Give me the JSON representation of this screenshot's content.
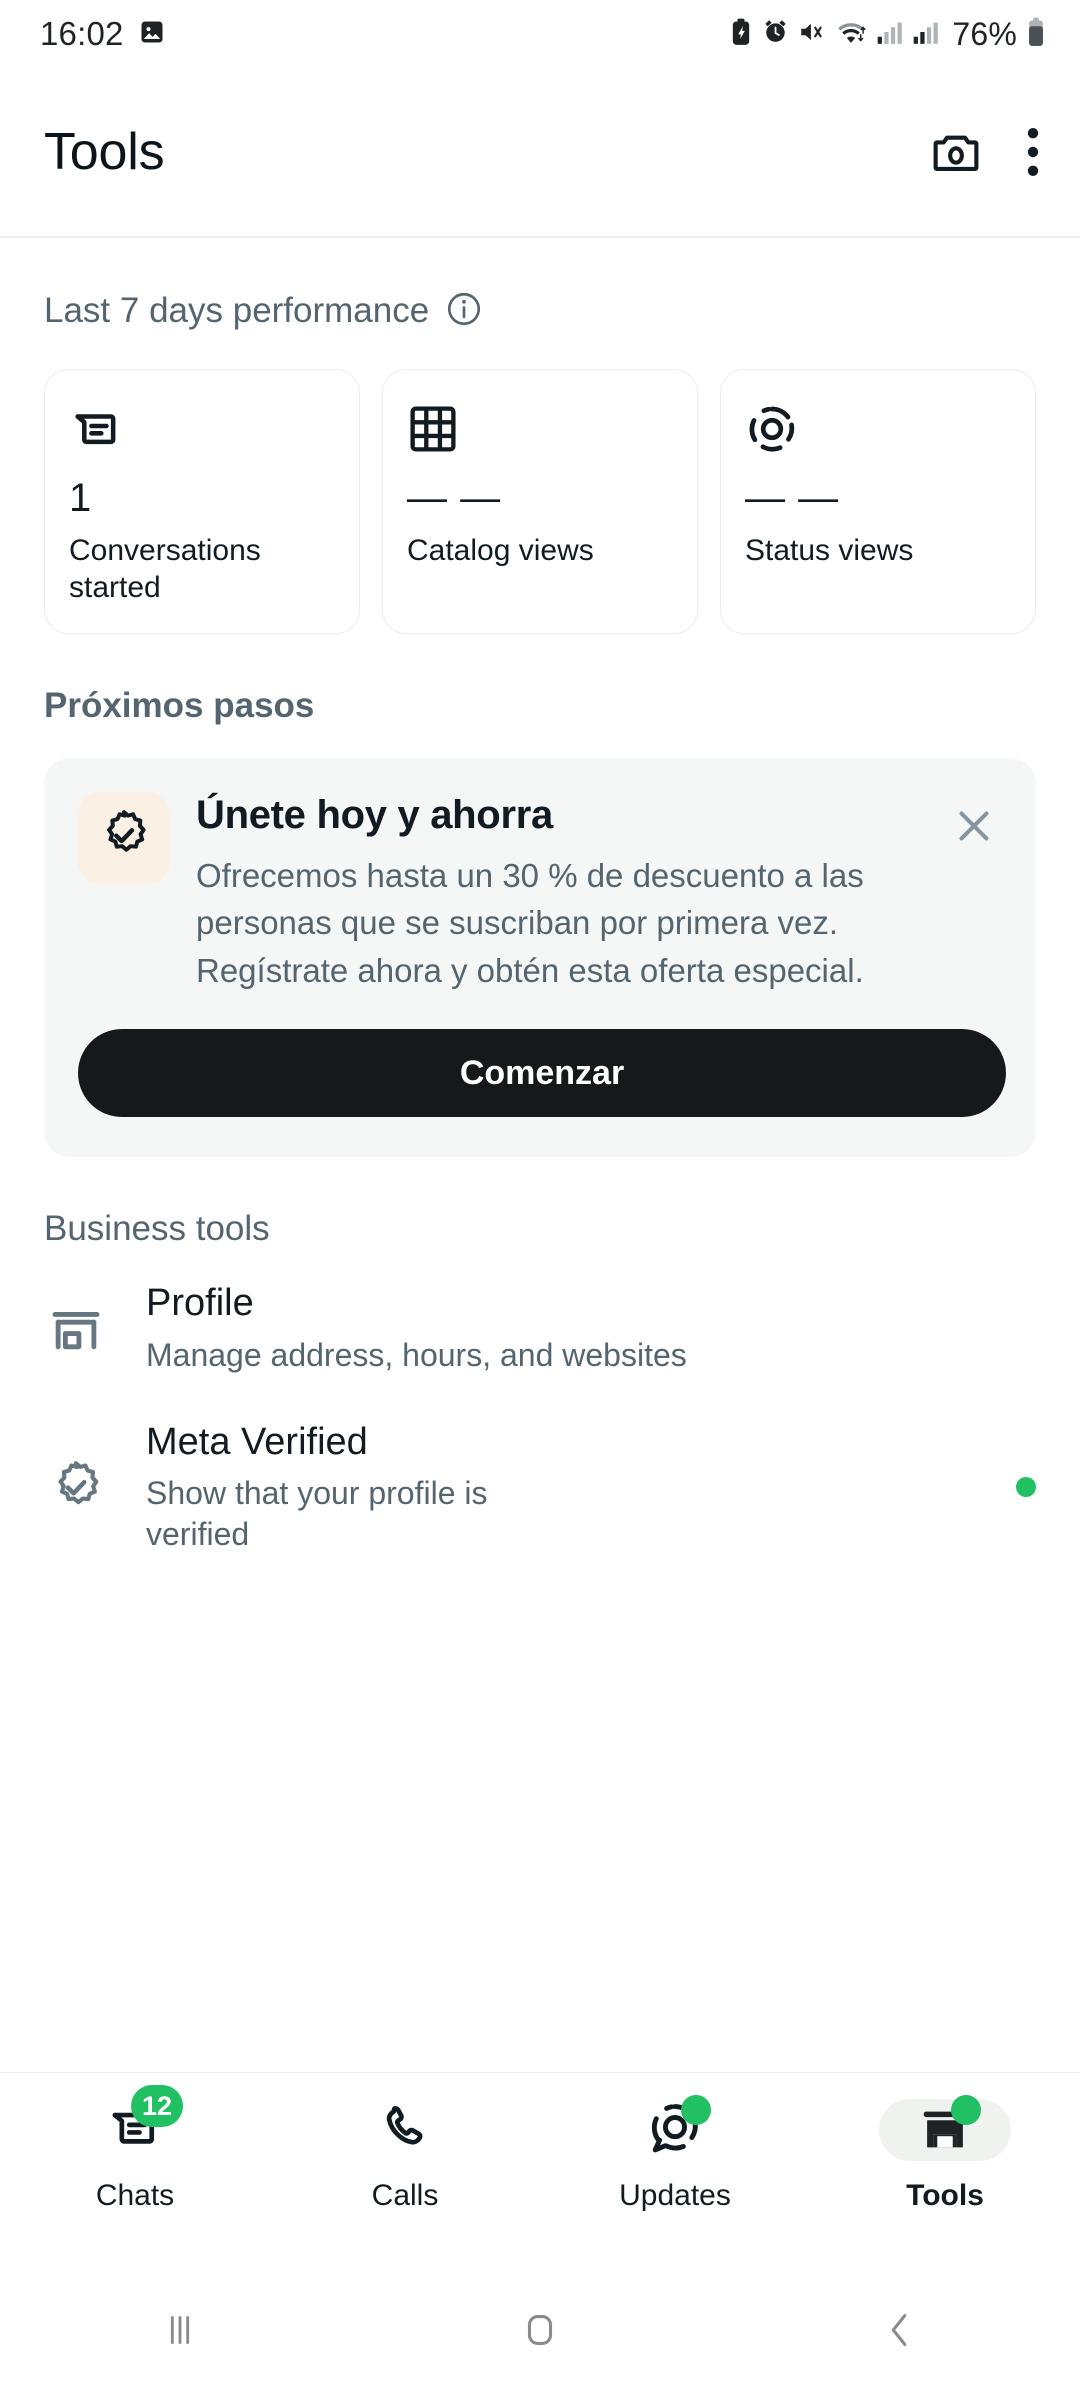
{
  "status_bar": {
    "time": "16:02",
    "battery_percent": "76%",
    "icons": [
      "gallery-icon",
      "battery-saver-icon",
      "alarm-icon",
      "mute-icon",
      "wifi-icon",
      "signal-1-icon",
      "signal-2-icon",
      "battery-icon"
    ]
  },
  "app_bar": {
    "title": "Tools",
    "camera_icon": "camera-icon",
    "overflow_icon": "overflow-menu-icon"
  },
  "performance": {
    "heading": "Last 7 days performance",
    "info_icon": "info-icon",
    "cards": [
      {
        "icon": "conversations-icon",
        "value": "1",
        "label": "Conversations started"
      },
      {
        "icon": "catalog-grid-icon",
        "value": "— —",
        "label": "Catalog views"
      },
      {
        "icon": "status-ring-icon",
        "value": "— —",
        "label": "Status views"
      }
    ]
  },
  "next_steps": {
    "heading": "Próximos pasos",
    "promo": {
      "icon": "verified-badge-icon",
      "title": "Únete hoy y ahorra",
      "body": "Ofrecemos hasta un 30 % de descuento a las personas que se suscriban por primera vez. Regístrate ahora y obtén esta oferta especial.",
      "button_label": "Comenzar",
      "close_icon": "close-icon"
    }
  },
  "business_tools": {
    "heading": "Business tools",
    "items": [
      {
        "icon": "storefront-icon",
        "title": "Profile",
        "subtitle": "Manage address, hours, and websites",
        "dot": false
      },
      {
        "icon": "verified-badge-icon",
        "title": "Meta Verified",
        "subtitle": "Show that your profile is verified",
        "dot": true
      }
    ]
  },
  "bottom_nav": {
    "items": [
      {
        "icon": "chats-icon",
        "label": "Chats",
        "badge": "12",
        "dot": false,
        "active": false
      },
      {
        "icon": "calls-icon",
        "label": "Calls",
        "badge": "",
        "dot": false,
        "active": false
      },
      {
        "icon": "updates-icon",
        "label": "Updates",
        "badge": "",
        "dot": true,
        "active": false
      },
      {
        "icon": "tools-icon",
        "label": "Tools",
        "badge": "",
        "dot": true,
        "active": true
      }
    ]
  },
  "system_nav": {
    "recents_icon": "recents-icon",
    "home_icon": "home-icon",
    "back_icon": "back-icon"
  },
  "colors": {
    "accent_green": "#21c063",
    "text_primary": "#111b21",
    "text_secondary": "#54656f",
    "card_bg": "#f5f6f6",
    "promo_icon_bg": "#fbf0e4",
    "button_black": "#15191c"
  }
}
